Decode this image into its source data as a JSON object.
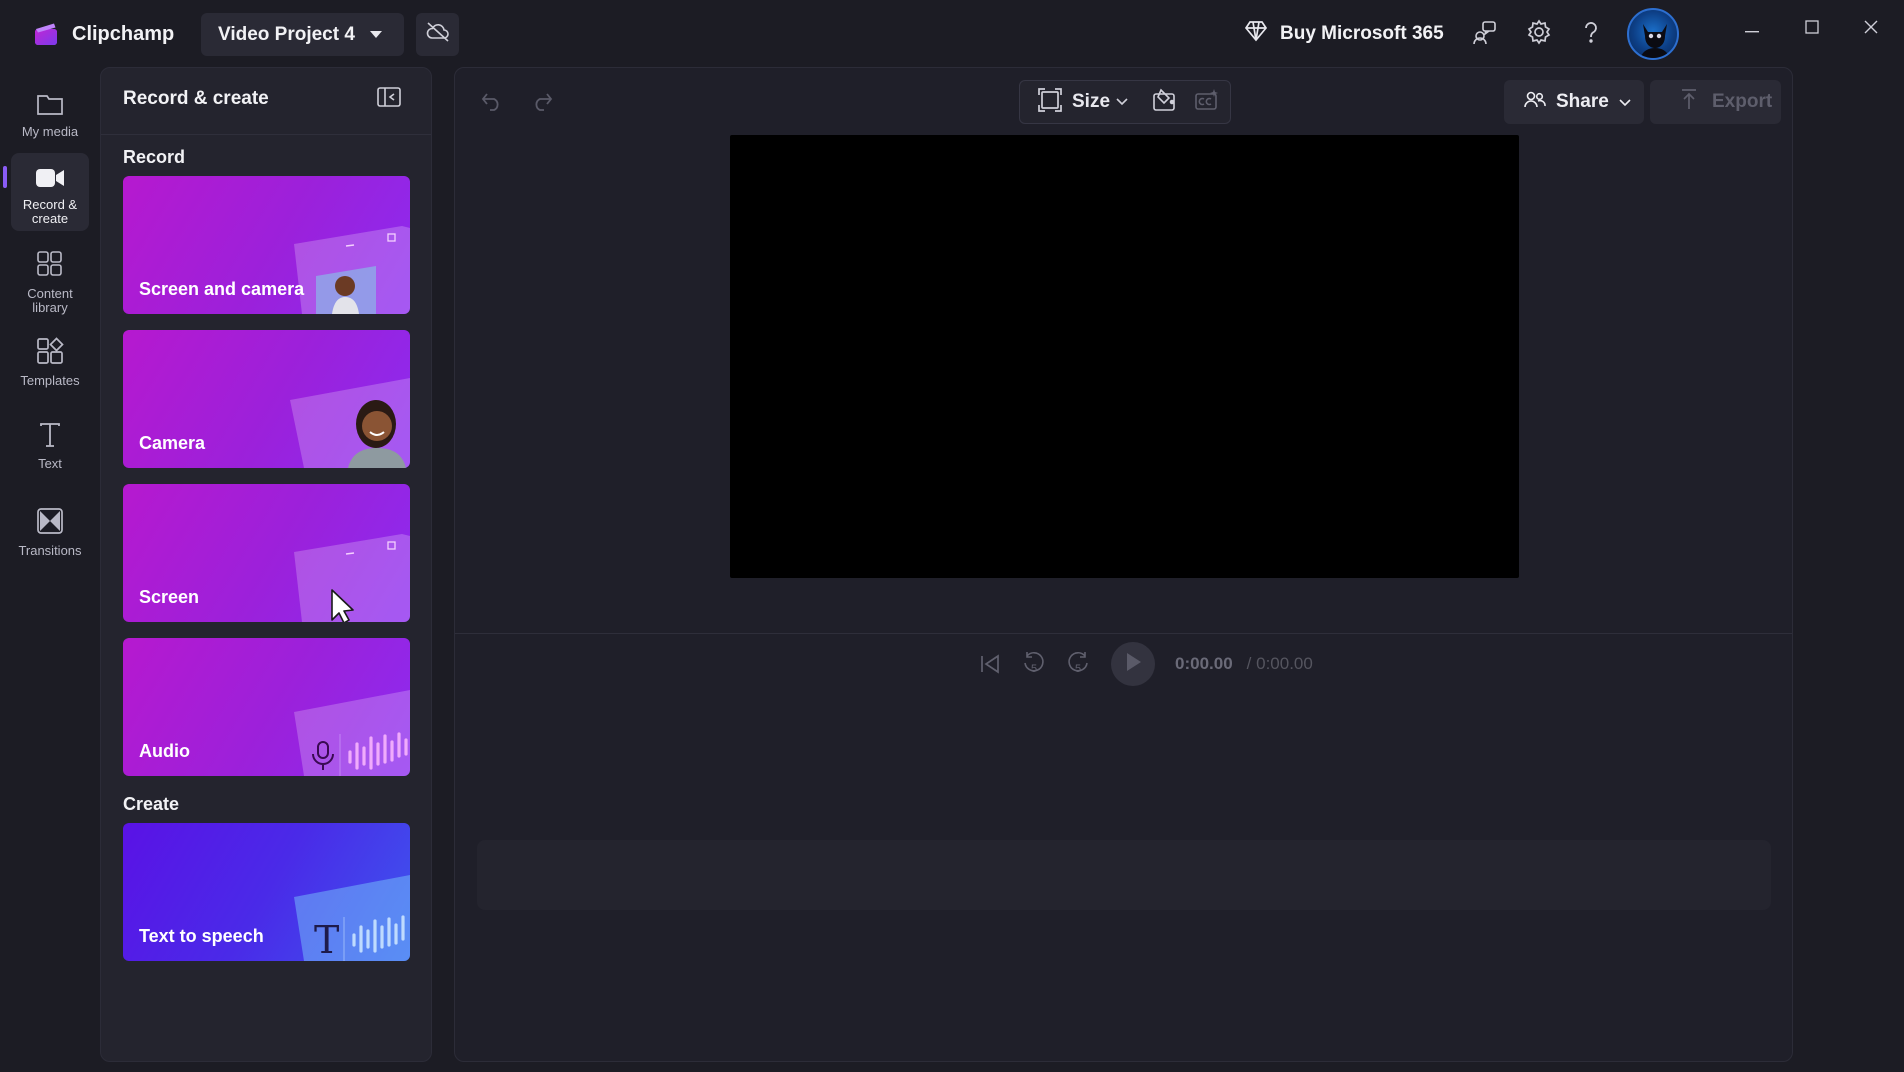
{
  "app": {
    "name": "Clipchamp",
    "project_title": "Video Project 4",
    "buy_label": "Buy Microsoft 365"
  },
  "rail": {
    "items": [
      {
        "label": "My media",
        "icon": "folder-icon"
      },
      {
        "label": "Record & create",
        "icon": "video-camera-icon"
      },
      {
        "label": "Content library",
        "icon": "content-library-icon"
      },
      {
        "label": "Templates",
        "icon": "templates-icon"
      },
      {
        "label": "Text",
        "icon": "text-icon"
      },
      {
        "label": "Transitions",
        "icon": "transitions-icon"
      }
    ]
  },
  "panel": {
    "title": "Record & create",
    "record_label": "Record",
    "create_label": "Create",
    "cards": [
      {
        "label": "Screen and camera"
      },
      {
        "label": "Camera"
      },
      {
        "label": "Screen"
      },
      {
        "label": "Audio"
      },
      {
        "label": "Text to speech"
      }
    ]
  },
  "editor": {
    "size_label": "Size",
    "share_label": "Share",
    "export_label": "Export",
    "time_current": "0:00.00",
    "time_total": "/ 0:00.00",
    "skip_back_seconds": "5",
    "skip_forward_seconds": "5"
  },
  "colors": {
    "accent": "#8a5cf6",
    "record_card": "#a91fd6",
    "tts_card": "#4a2ae8",
    "background": "#1c1c24"
  }
}
